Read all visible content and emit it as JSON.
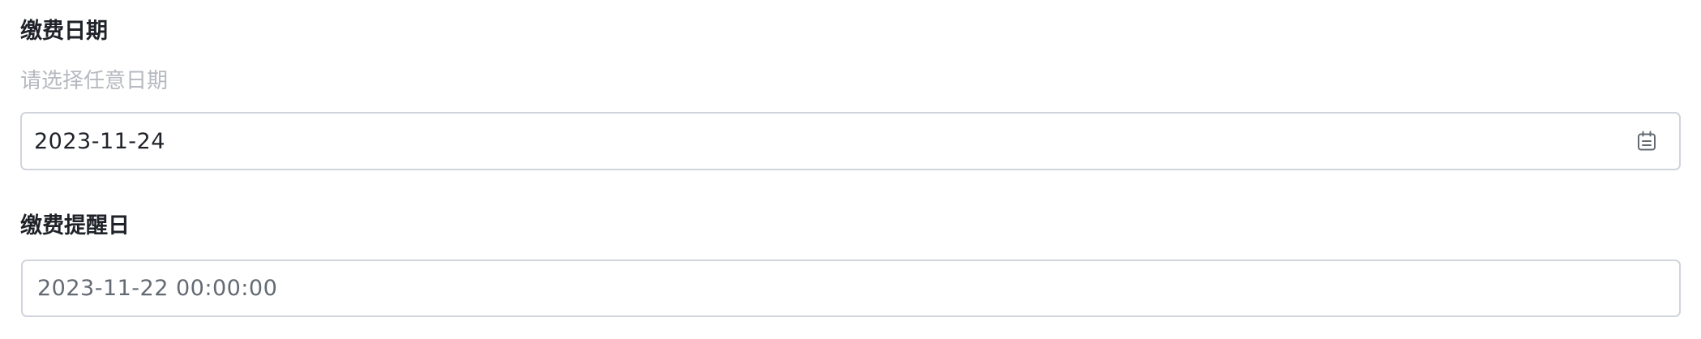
{
  "payment_date": {
    "label": "缴费日期",
    "hint": "请选择任意日期",
    "value": "2023-11-24",
    "icon": "calendar-icon"
  },
  "reminder_date": {
    "label": "缴费提醒日",
    "value": "2023-11-22 00:00:00"
  }
}
